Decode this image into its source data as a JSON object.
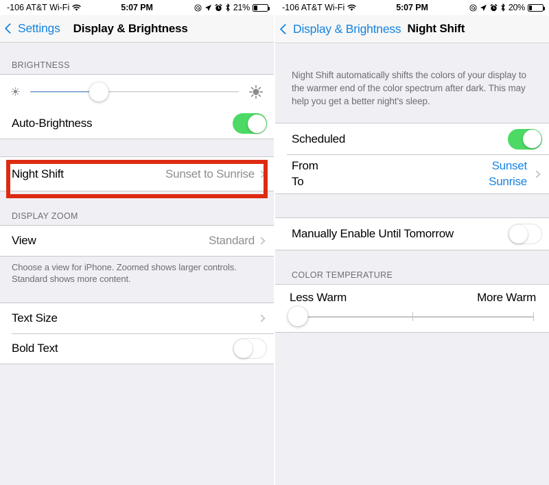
{
  "left_panel": {
    "status_bar": {
      "carrier": "-106 AT&T Wi-Fi",
      "wifi_icon": "wifi-icon",
      "time": "5:07 PM",
      "icons": [
        "do-not-disturb-icon",
        "location-arrow-icon",
        "alarm-clock-icon",
        "bluetooth-icon"
      ],
      "battery_percent": "21%",
      "battery_level": 21
    },
    "nav": {
      "back_label": "Settings",
      "title": "Display & Brightness"
    },
    "brightness": {
      "section_header": "BRIGHTNESS",
      "slider_value": 33,
      "low_icon": "sun-small-icon",
      "high_icon": "sun-large-icon",
      "auto_brightness_label": "Auto-Brightness",
      "auto_brightness_on": true
    },
    "night_shift": {
      "label": "Night Shift",
      "value": "Sunset to Sunrise",
      "highlighted": true,
      "highlight_color": "#DD2B12"
    },
    "display_zoom": {
      "section_header": "DISPLAY ZOOM",
      "view_label": "View",
      "view_value": "Standard",
      "footnote": "Choose a view for iPhone. Zoomed shows larger controls. Standard shows more content."
    },
    "text_settings": {
      "text_size_label": "Text Size",
      "bold_text_label": "Bold Text",
      "bold_text_on": false
    }
  },
  "right_panel": {
    "status_bar": {
      "carrier": "-106 AT&T Wi-Fi",
      "wifi_icon": "wifi-icon",
      "time": "5:07 PM",
      "icons": [
        "do-not-disturb-icon",
        "location-arrow-icon",
        "alarm-clock-icon",
        "bluetooth-icon"
      ],
      "battery_percent": "20%",
      "battery_level": 20
    },
    "nav": {
      "back_label": "Display & Brightness",
      "title": "Night Shift"
    },
    "description": "Night Shift automatically shifts the colors of your display to the warmer end of the color spectrum after dark. This may help you get a better night's sleep.",
    "scheduled": {
      "label": "Scheduled",
      "on": true
    },
    "schedule_times": {
      "from_label": "From",
      "from_value": "Sunset",
      "to_label": "To",
      "to_value": "Sunrise",
      "value_color": "#1683E0"
    },
    "manual": {
      "label": "Manually Enable Until Tomorrow",
      "on": false
    },
    "color_temperature": {
      "section_header": "COLOR TEMPERATURE",
      "less_warm_label": "Less Warm",
      "more_warm_label": "More Warm",
      "slider_value": 0,
      "ticks": [
        50,
        100
      ]
    }
  },
  "colors": {
    "accent_blue": "#1683E0",
    "toggle_green": "#4CD964",
    "highlight_red": "#DD2B12",
    "background_gray": "#EFEFF4"
  }
}
